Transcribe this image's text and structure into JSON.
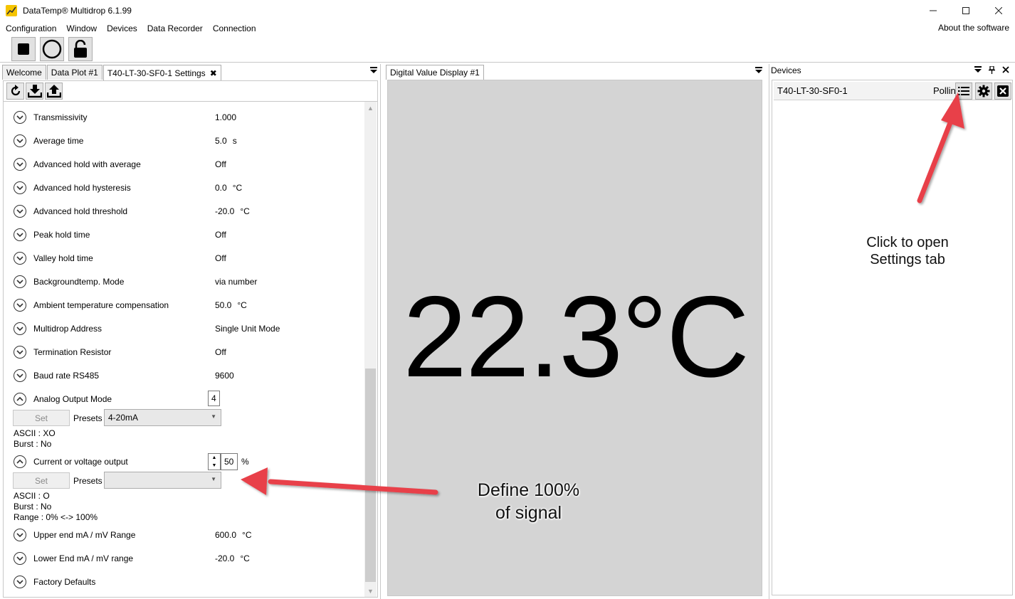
{
  "window": {
    "title": "DataTemp® Multidrop 6.1.99",
    "minimize": "—",
    "maximize": "☐",
    "close": "✕"
  },
  "menu": {
    "items": [
      "Configuration",
      "Window",
      "Devices",
      "Data Recorder",
      "Connection"
    ],
    "about": "About the software"
  },
  "tabs": {
    "welcome": "Welcome",
    "dataplot": "Data Plot #1",
    "settings": "T40-LT-30-SF0-1 Settings",
    "close": "✖"
  },
  "settings": {
    "rows": [
      {
        "label": "Transmissivity",
        "value": "1.000",
        "unit": ""
      },
      {
        "label": "Average time",
        "value": "5.0",
        "unit": "s"
      },
      {
        "label": "Advanced hold with average",
        "value": "Off",
        "unit": ""
      },
      {
        "label": "Advanced hold hysteresis",
        "value": "0.0",
        "unit": "°C"
      },
      {
        "label": "Advanced hold threshold",
        "value": "-20.0",
        "unit": "°C"
      },
      {
        "label": "Peak hold time",
        "value": "Off",
        "unit": ""
      },
      {
        "label": "Valley hold time",
        "value": "Off",
        "unit": ""
      },
      {
        "label": "Backgroundtemp. Mode",
        "value": "via number",
        "unit": ""
      },
      {
        "label": "Ambient temperature compensation",
        "value": "50.0",
        "unit": "°C"
      },
      {
        "label": "Multidrop Address",
        "value": "Single Unit Mode",
        "unit": ""
      },
      {
        "label": "Termination Resistor",
        "value": "Off",
        "unit": ""
      },
      {
        "label": "Baud rate RS485",
        "value": "9600",
        "unit": ""
      }
    ],
    "analog": {
      "label": "Analog Output Mode",
      "value": "4",
      "set": "Set",
      "presets_label": "Presets",
      "preset": "4-20mA",
      "ascii": "ASCII : XO",
      "burst": "Burst : No"
    },
    "current": {
      "label": "Current or voltage output",
      "value": "50",
      "unit": "%",
      "set": "Set",
      "presets_label": "Presets",
      "preset": "",
      "ascii": "ASCII : O",
      "burst": "Burst : No",
      "range": "Range : 0% <-> 100%"
    },
    "rows_after": [
      {
        "label": "Upper end mA / mV Range",
        "value": "600.0",
        "unit": "°C"
      },
      {
        "label": "Lower End mA / mV range",
        "value": "-20.0",
        "unit": "°C"
      },
      {
        "label": "Factory Defaults",
        "value": "",
        "unit": ""
      }
    ]
  },
  "display": {
    "tab": "Digital Value Display #1",
    "value": "22.3°C"
  },
  "devices": {
    "title": "Devices",
    "pin": "📌",
    "close": "✕",
    "device_name": "T40-LT-30-SF0-1",
    "status": "Polling"
  },
  "annotations": {
    "settings_tab_line1": "Click to open",
    "settings_tab_line2": "Settings tab",
    "define_line1": "Define 100%",
    "define_line2": "of signal",
    "arrow_color": "#e8414a"
  }
}
